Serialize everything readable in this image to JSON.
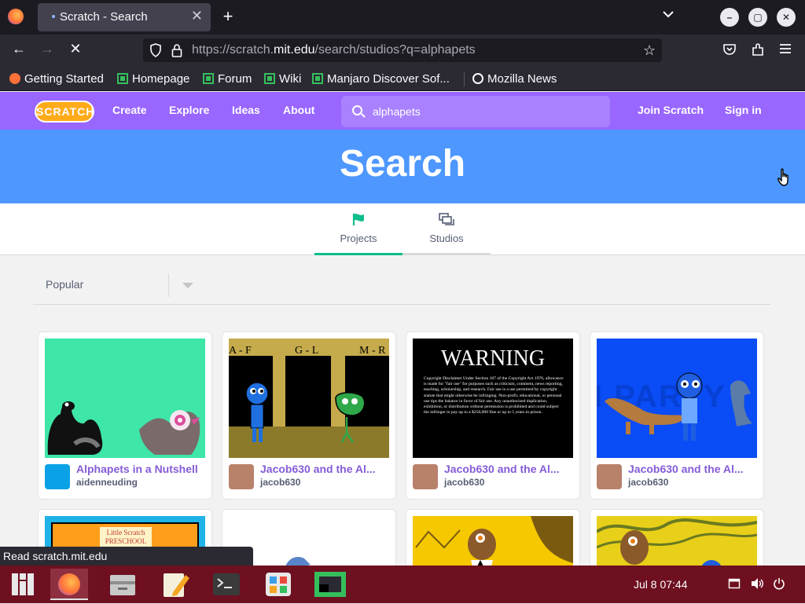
{
  "browser": {
    "tab_title": "Scratch - Search",
    "tab_close": "✕",
    "new_tab": "+",
    "url_prefix": "https://scratch.",
    "url_host": "mit.edu",
    "url_path": "/search/studios?q=alphapets",
    "bookmarks": [
      "Getting Started",
      "Homepage",
      "Forum",
      "Wiki",
      "Manjaro Discover Sof...",
      "Mozilla News"
    ]
  },
  "scratch": {
    "logo": "SCRATCH",
    "nav": [
      "Create",
      "Explore",
      "Ideas",
      "About"
    ],
    "search_value": "alphapets",
    "join": "Join Scratch",
    "signin": "Sign in",
    "banner_title": "Search",
    "tabs": [
      {
        "label": "Projects",
        "active": true
      },
      {
        "label": "Studios",
        "active": false
      }
    ],
    "sort_value": "Popular",
    "projects": [
      {
        "title": "Alphapets in a Nutshell",
        "owner": "aidenneuding"
      },
      {
        "title": "Jacob630 and the Al...",
        "owner": "jacob630"
      },
      {
        "title": "Jacob630 and the Al...",
        "owner": "jacob630"
      },
      {
        "title": "Jacob630 and the Al...",
        "owner": "jacob630"
      }
    ],
    "thumb2_labels": [
      "A - F",
      "G - L",
      "M - R"
    ],
    "thumb3_title": "WARNING",
    "thumb3_text": "Copyright Disclaimer Under Section 107 of the Copyright Act 1976, allowance is made for \"fair use\" for purposes such as criticism, comment, news reporting, teaching, scholarship, and research. Fair use is a use permitted by copyright statute that might otherwise be infringing. Non-profit, educational, or personal use tips the balance in favor of fair use. Any unauthorized duplication, exhibition, or distribution without permission is prohibited and could subject the infringer to pay up to a $250,000 fine or up to 5 years in prison.",
    "thumb4_text": "I PARTY",
    "thumb5_text": "Little Scratch PRESCHOOL"
  },
  "statusbar": {
    "text": "Read scratch.mit.edu"
  },
  "taskbar": {
    "clock": "Jul 8  07:44"
  },
  "colors": {
    "scratch_purple": "#9966ff",
    "scratch_blue": "#4d97ff",
    "tab_active": "#0fbd8c",
    "taskbar": "#6e1020"
  }
}
